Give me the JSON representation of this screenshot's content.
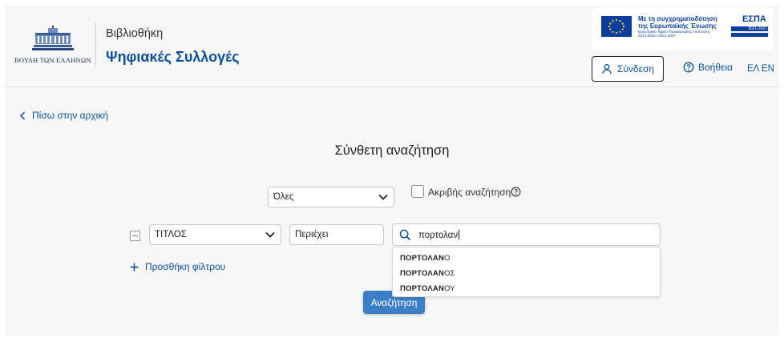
{
  "header": {
    "logo_text": "ΒΟΥΛΗ ΤΩΝ ΕΛΛΗΝΩΝ",
    "site_subtitle": "Βιβλιοθήκη",
    "site_title": "Ψηφιακές Συλλογές",
    "espa_banner": {
      "line1": "Με τη συγχρηματοδότηση",
      "line2": "της Ευρωπαϊκής Ένωσης",
      "line3": "Ευρωπαϊκό Ταμείο Περιφερειακής Ανάπτυξης",
      "line4": "2014-2020 / 2021-2027",
      "logo": "ΕΣΠΑ",
      "logo_years": "2021-2027"
    },
    "login_label": "Σύνδεση",
    "help_label": "Βοήθεια",
    "lang_el": "ΕΛ",
    "lang_en": "EN"
  },
  "back_link": "Πίσω στην αρχική",
  "page_title": "Σύνθετη αναζήτηση",
  "scope_select": {
    "value": "Όλες"
  },
  "exact_search": {
    "label": "Ακριβής αναζήτηση",
    "checked": false
  },
  "filter_row": {
    "field": "ΤΙΤΛΟΣ",
    "operator": "Περιέχει",
    "query": "πορτολαν"
  },
  "suggestions": [
    {
      "match": "ΠΟΡΤΟΛΑΝ",
      "rest": "Ο"
    },
    {
      "match": "ΠΟΡΤΟΛΑΝ",
      "rest": "ΟΣ"
    },
    {
      "match": "ΠΟΡΤΟΛΑΝ",
      "rest": "ΟΥ"
    }
  ],
  "add_filter_label": "Προσθήκη φίλτρου",
  "search_button_label": "Αναζήτηση",
  "colors": {
    "accent": "#0b4f9c",
    "button": "#3d7fc6",
    "background": "#f7f7f7"
  },
  "icons": [
    "user-icon",
    "help-circle-icon",
    "chevron-left-icon",
    "chevron-down-icon",
    "search-icon",
    "plus-icon",
    "minus-square-icon",
    "eu-flag-icon"
  ]
}
